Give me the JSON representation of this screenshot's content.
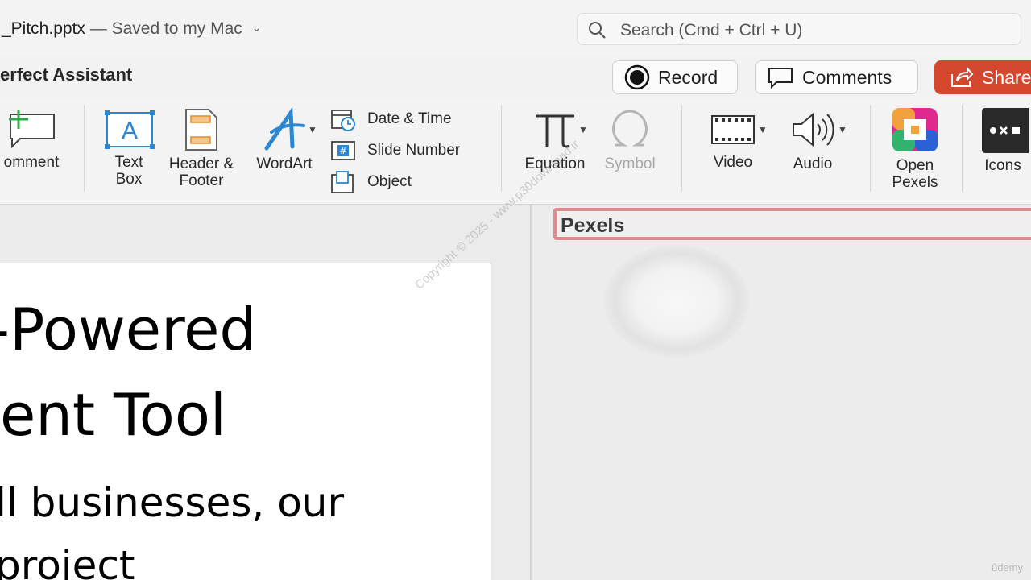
{
  "titlebar": {
    "filename": "_Pitch.pptx",
    "saved_status": "— Saved to my Mac",
    "search_placeholder": "Search (Cmd + Ctrl + U)"
  },
  "ribbon_top": {
    "assistant_label": "erfect Assistant",
    "record_label": "Record",
    "comments_label": "Comments",
    "share_label": "Share"
  },
  "ribbon": {
    "comment_label": "omment",
    "textbox_label": [
      "Text",
      "Box"
    ],
    "header_footer_label": [
      "Header &",
      "Footer"
    ],
    "wordart_label": "WordArt",
    "date_time_label": "Date & Time",
    "slide_number_label": "Slide Number",
    "object_label": "Object",
    "equation_label": "Equation",
    "symbol_label": "Symbol",
    "video_label": "Video",
    "audio_label": "Audio",
    "open_pexels_label": [
      "Open",
      "Pexels"
    ],
    "icons_label": "Icons"
  },
  "slide": {
    "lines": [
      "-Powered",
      "ent Tool",
      "ll businesses, our",
      "project"
    ]
  },
  "pane": {
    "title": "Pexels"
  },
  "overlay": {
    "watermark": "Copyright © 2025 - www.p30download.ir",
    "corner": "ûdemy"
  },
  "colors": {
    "share_button": "#d3472f",
    "pane_header_border": "#e08a8f",
    "accent_blue": "#2b87d1"
  }
}
